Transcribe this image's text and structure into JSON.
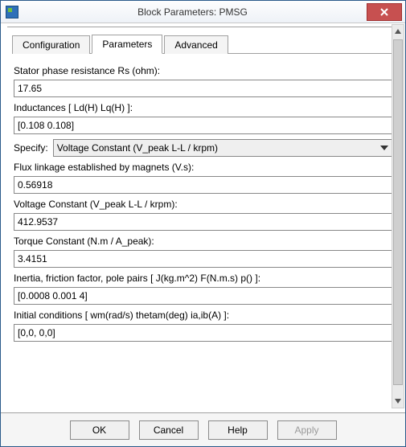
{
  "window": {
    "title": "Block Parameters: PMSG"
  },
  "tabs": {
    "config": "Configuration",
    "params": "Parameters",
    "adv": "Advanced",
    "active": "params"
  },
  "fields": {
    "rs_label": "Stator phase resistance Rs (ohm):",
    "rs_value": "17.65",
    "ld_label": "Inductances [ Ld(H) Lq(H) ]:",
    "ld_value": "[0.108 0.108]",
    "specify_label": "Specify:",
    "specify_value": "Voltage Constant (V_peak L-L / krpm)",
    "flux_label": "Flux linkage established by magnets (V.s):",
    "flux_value": "0.56918",
    "vconst_label": "Voltage Constant (V_peak L-L / krpm):",
    "vconst_value": "412.9537",
    "tconst_label": "Torque Constant (N.m / A_peak):",
    "tconst_value": "3.4151",
    "inertia_label": "Inertia, friction factor, pole pairs [ J(kg.m^2)  F(N.m.s)  p() ]:",
    "inertia_value": "[0.0008 0.001 4]",
    "init_label": "Initial conditions  [ wm(rad/s)  thetam(deg)  ia,ib(A) ]:",
    "init_value": "[0,0, 0,0]"
  },
  "buttons": {
    "ok": "OK",
    "cancel": "Cancel",
    "help": "Help",
    "apply": "Apply"
  }
}
